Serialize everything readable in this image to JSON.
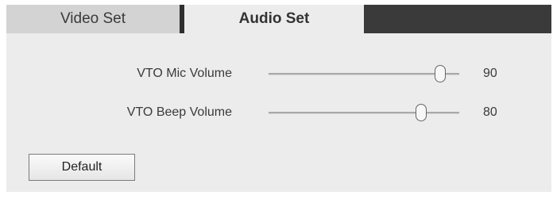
{
  "tabs": [
    {
      "label": "Video Set",
      "active": false
    },
    {
      "label": "Audio Set",
      "active": true
    }
  ],
  "audio": {
    "mic": {
      "label": "VTO Mic Volume",
      "value": "90",
      "level": 0.9
    },
    "beep": {
      "label": "VTO Beep Volume",
      "value": "80",
      "level": 0.8
    }
  },
  "buttons": {
    "default_label": "Default"
  },
  "colors": {
    "tabbar_dark": "#3a3a3a",
    "panel_bg": "#ececec",
    "inactive_tab": "#d3d3d3"
  }
}
